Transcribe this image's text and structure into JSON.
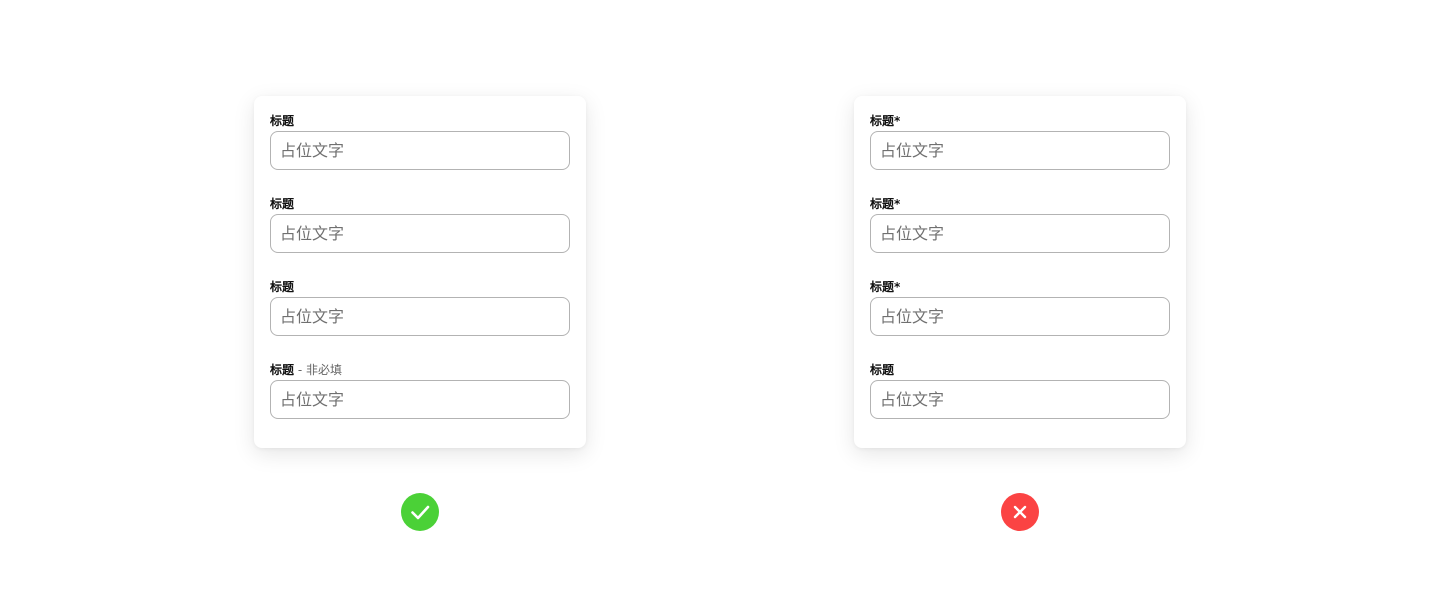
{
  "good_example": {
    "fields": [
      {
        "label": "标题",
        "optional_note": "",
        "placeholder": "占位文字"
      },
      {
        "label": "标题",
        "optional_note": "",
        "placeholder": "占位文字"
      },
      {
        "label": "标题",
        "optional_note": "",
        "placeholder": "占位文字"
      },
      {
        "label": "标题",
        "optional_note": " - 非必填",
        "placeholder": "占位文字"
      }
    ],
    "verdict_icon": "checkmark-icon",
    "verdict_color": "#4bd137"
  },
  "bad_example": {
    "fields": [
      {
        "label": "标题*",
        "placeholder": "占位文字"
      },
      {
        "label": "标题*",
        "placeholder": "占位文字"
      },
      {
        "label": "标题*",
        "placeholder": "占位文字"
      },
      {
        "label": "标题",
        "placeholder": "占位文字"
      }
    ],
    "verdict_icon": "close-icon",
    "verdict_color": "#fb4343"
  }
}
